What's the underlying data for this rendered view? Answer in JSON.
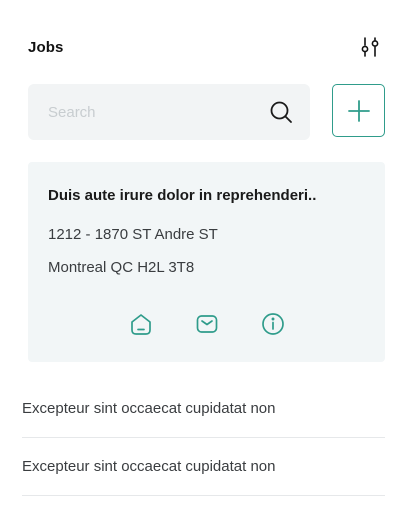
{
  "header": {
    "title": "Jobs",
    "filter_icon": "sliders-icon"
  },
  "search": {
    "placeholder": "Search",
    "value": "",
    "icon": "search-icon"
  },
  "add_button": {
    "icon": "plus-icon"
  },
  "job_card": {
    "title": "Duis aute irure dolor in reprehenderi..",
    "address_line1": "1212 - 1870 ST Andre ST",
    "address_line2": "Montreal QC H2L 3T8",
    "actions": [
      {
        "icon": "home-icon"
      },
      {
        "icon": "mail-icon"
      },
      {
        "icon": "info-icon"
      }
    ]
  },
  "list": {
    "items": [
      {
        "label": "Excepteur sint occaecat cupidatat non"
      },
      {
        "label": "Excepteur sint occaecat cupidatat non"
      }
    ]
  },
  "colors": {
    "accent": "#2f9c8b",
    "card_background": "#f2f6f7",
    "search_background": "#f2f4f5"
  }
}
